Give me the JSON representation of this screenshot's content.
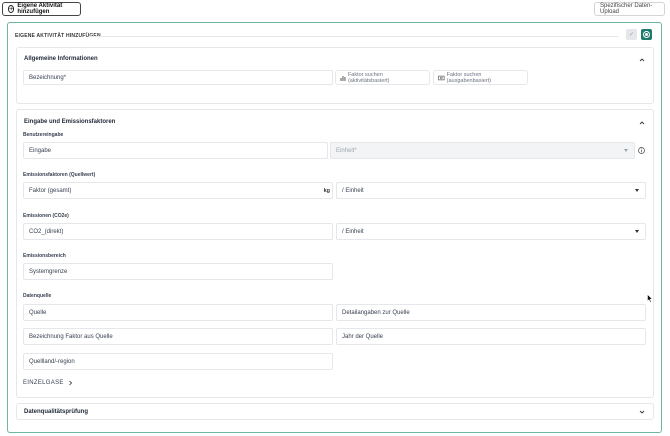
{
  "header": {
    "add_own_activity_label": "Eigene Aktivität hinzufügen",
    "specific_upload_label": "Spezifischer Daten-Upload"
  },
  "panel": {
    "title": "EIGENE AKTIVITÄT HINZUFÜGEN",
    "check_icon": "✓"
  },
  "general": {
    "title": "Allgemeine Informationen",
    "name_placeholder": "Bezeichnung*",
    "search_activity_label": "Faktor suchen (aktivitätsbasiert)",
    "search_expense_label": "Faktor suchen (ausgabenbasiert)"
  },
  "emissions": {
    "title": "Eingabe und Emissionsfaktoren",
    "user_input_label": "Benutzereingabe",
    "input_placeholder": "Eingabe",
    "unit_placeholder": "Einheit*",
    "factors_label": "Emissionsfaktoren (Quellwert)",
    "factor_placeholder": "Faktor (gesamt)",
    "factor_unit": "kg",
    "per_unit_label": "/ Einheit",
    "co2e_label": "Emissionen (CO2e)",
    "co2_direct_placeholder": "CO2_(direkt)",
    "co2_per_unit_label": "/ Einheit",
    "scope_label": "Emissionsbereich",
    "system_boundary_placeholder": "Systemgrenze",
    "source_label": "Datenquelle",
    "source_placeholder": "Quelle",
    "source_details_placeholder": "Detailangaben zur Quelle",
    "factor_name_placeholder": "Bezeichnung Faktor aus Quelle",
    "source_year_placeholder": "Jahr der Quelle",
    "source_country_placeholder": "Quellland/-region",
    "single_gases_label": "EINZELGASE"
  },
  "quality": {
    "title": "Datenqualitätsprüfung"
  },
  "colors": {
    "accent": "#1e7a6b",
    "border_accent": "#6fb5a4"
  }
}
